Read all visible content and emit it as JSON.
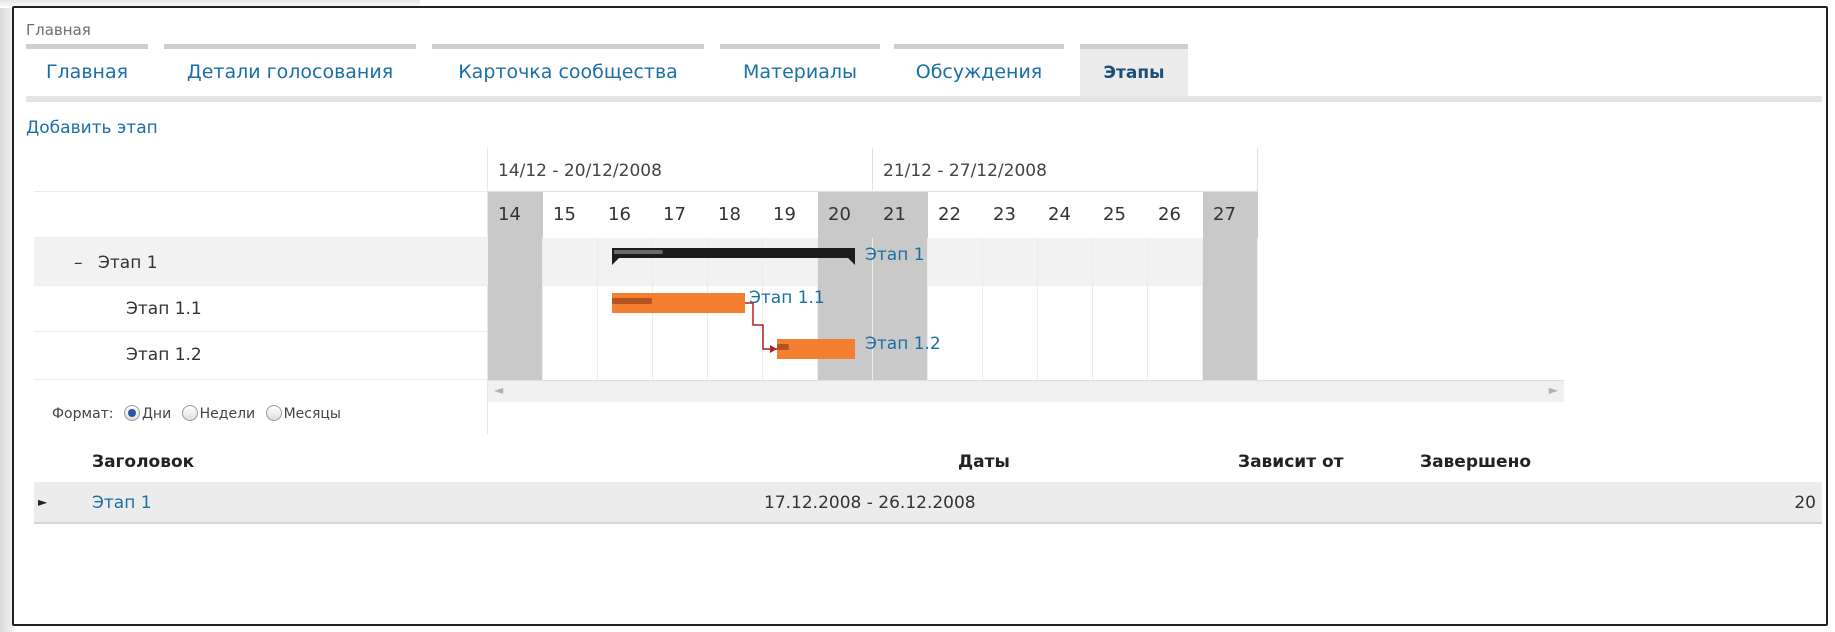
{
  "breadcrumb": "Главная",
  "tabs": [
    {
      "label": "Главная",
      "active": false
    },
    {
      "label": "Детали голосования",
      "active": false
    },
    {
      "label": "Карточка сообщества",
      "active": false
    },
    {
      "label": "Материалы",
      "active": false
    },
    {
      "label": "Обсуждения",
      "active": false
    },
    {
      "label": "Этапы",
      "active": true
    }
  ],
  "add_stage_link": "Добавить этап",
  "gantt": {
    "weeks": [
      "14/12 - 20/12/2008",
      "21/12 - 27/12/2008"
    ],
    "days": [
      "14",
      "15",
      "16",
      "17",
      "18",
      "19",
      "20",
      "21",
      "22",
      "23",
      "24",
      "25",
      "26",
      "27"
    ],
    "weekend_days": [
      "14",
      "20",
      "21",
      "27"
    ],
    "tasks": [
      {
        "toggle": "–",
        "label": "Этап 1",
        "bar_label": "Этап 1",
        "start_day": "16",
        "end_day": "20",
        "type": "summary",
        "progress": 0.2
      },
      {
        "label": "Этап 1.1",
        "bar_label": "Этап 1.1",
        "start_day": "16",
        "end_day": "18",
        "type": "task",
        "progress": 0.3
      },
      {
        "label": "Этап 1.2",
        "bar_label": "Этап 1.2",
        "start_day": "19",
        "end_day": "20",
        "type": "task",
        "progress": 0.15
      }
    ],
    "dependency": {
      "from": "Этап 1.1",
      "to": "Этап 1.2"
    },
    "colors": {
      "summary_bar": "#1c1c1c",
      "task_bar": "#f47f31",
      "task_progress": "#b3541e",
      "dependency": "#b22222",
      "weekend": "#c9c9c9"
    },
    "format": {
      "label": "Формат:",
      "options": [
        {
          "label": "Дни",
          "selected": true
        },
        {
          "label": "Недели",
          "selected": false
        },
        {
          "label": "Месяцы",
          "selected": false
        }
      ]
    }
  },
  "table": {
    "headers": {
      "title": "Заголовок",
      "dates": "Даты",
      "depends": "Зависит от",
      "completed": "Завершено"
    },
    "rows": [
      {
        "title": "Этап 1",
        "dates": "17.12.2008 - 26.12.2008",
        "depends": "",
        "completed": "20"
      }
    ]
  }
}
